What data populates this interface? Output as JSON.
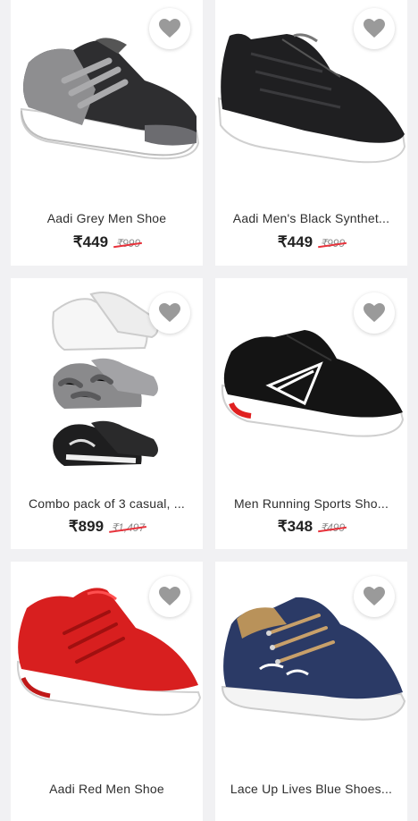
{
  "products": [
    {
      "name": "Aadi Grey Men Shoe",
      "price": "₹449",
      "mrp": "₹999"
    },
    {
      "name": "Aadi Men's Black Synthet...",
      "price": "₹449",
      "mrp": "₹999"
    },
    {
      "name": "Combo pack of 3 casual, ...",
      "price": "₹899",
      "mrp": "₹1,497"
    },
    {
      "name": "Men Running Sports Sho...",
      "price": "₹348",
      "mrp": "₹499"
    },
    {
      "name": "Aadi Red Men Shoe",
      "price": "",
      "mrp": ""
    },
    {
      "name": "Lace Up Lives Blue Shoes...",
      "price": "",
      "mrp": ""
    }
  ],
  "icons": {
    "wishlist": "heart-icon"
  },
  "colors": {
    "background": "#f1f1f3",
    "card": "#ffffff",
    "strike": "#e8333c",
    "heart": "#9a9a9a"
  }
}
